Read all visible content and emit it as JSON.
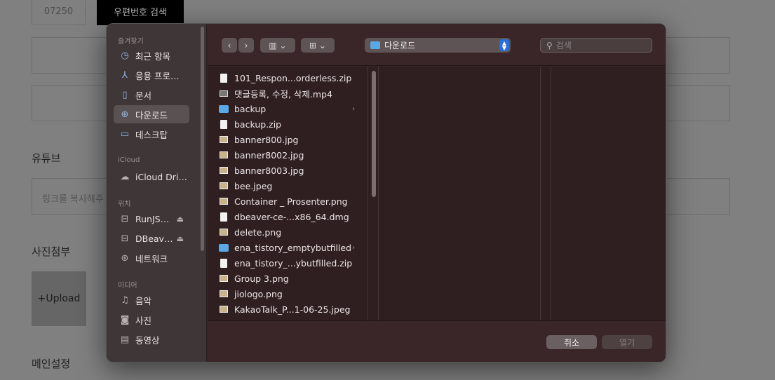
{
  "background": {
    "zipcode_value": "07250",
    "zipcode_button": "우편번호 검색",
    "youtube_label": "유튜브",
    "youtube_placeholder": "링크를 복사해주",
    "photo_label": "사진첨부",
    "upload_label": "+Upload",
    "main_setting_label": "메인설정"
  },
  "sidebar": {
    "favorites_label": "즐겨찾기",
    "favorites": [
      {
        "label": "최근 항목",
        "icon": "clock-icon"
      },
      {
        "label": "응용 프로…",
        "icon": "applications-icon"
      },
      {
        "label": "문서",
        "icon": "document-icon"
      },
      {
        "label": "다운로드",
        "icon": "download-icon"
      },
      {
        "label": "데스크탑",
        "icon": "desktop-icon"
      }
    ],
    "icloud_label": "iCloud",
    "icloud": [
      {
        "label": "iCloud Dri…",
        "icon": "cloud-icon"
      }
    ],
    "locations_label": "위치",
    "locations": [
      {
        "label": "RunJS…",
        "icon": "drive-icon"
      },
      {
        "label": "DBeav…",
        "icon": "drive-icon"
      },
      {
        "label": "네트워크",
        "icon": "network-icon"
      }
    ],
    "media_label": "미디어",
    "media": [
      {
        "label": "음악",
        "icon": "music-icon"
      },
      {
        "label": "사진",
        "icon": "camera-icon"
      },
      {
        "label": "동영상",
        "icon": "film-icon"
      }
    ]
  },
  "toolbar": {
    "location": "다운로드",
    "search_placeholder": "검색"
  },
  "files": [
    {
      "name": "101_Respon...orderless.zip",
      "type": "doc"
    },
    {
      "name": "댓글등록, 수정, 삭제.mp4",
      "type": "vid"
    },
    {
      "name": "backup",
      "type": "folder"
    },
    {
      "name": "backup.zip",
      "type": "doc"
    },
    {
      "name": "banner800.jpg",
      "type": "img"
    },
    {
      "name": "banner8002.jpg",
      "type": "img"
    },
    {
      "name": "banner8003.jpg",
      "type": "img"
    },
    {
      "name": "bee.jpeg",
      "type": "img"
    },
    {
      "name": "Container _ Prosenter.png",
      "type": "img"
    },
    {
      "name": "dbeaver-ce-...x86_64.dmg",
      "type": "doc"
    },
    {
      "name": "delete.png",
      "type": "img"
    },
    {
      "name": "ena_tistory_emptybutfilled",
      "type": "folder"
    },
    {
      "name": "ena_tistory_...ybutfilled.zip",
      "type": "doc"
    },
    {
      "name": "Group 3.png",
      "type": "img"
    },
    {
      "name": "jiologo.png",
      "type": "img"
    },
    {
      "name": "KakaoTalk_P...1-06-25.jpeg",
      "type": "img"
    }
  ],
  "footer": {
    "cancel_label": "취소",
    "open_label": "열기"
  }
}
